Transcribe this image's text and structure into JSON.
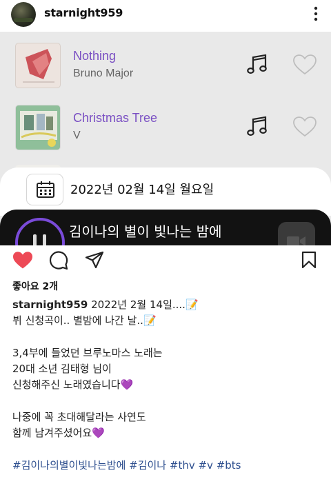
{
  "post": {
    "username": "starnight959",
    "likes": "좋아요 2개"
  },
  "playlist": [
    {
      "title": "Nothing",
      "artist": "Bruno Major"
    },
    {
      "title": "Christmas Tree",
      "artist": "V"
    }
  ],
  "date_card": {
    "date": "2022년 02월 14일 월요일"
  },
  "player": {
    "show_title": "김이나의 별이 빛나는 밤에"
  },
  "caption": {
    "username": "starnight959",
    "line1": "2022년 2월 14일....📝",
    "line2": "뷔 신청곡이.. 별밤에 나간 날..📝",
    "line3": "3,4부에 들었던 브루노마스 노래는",
    "line4": "20대 소년 김태형 님이",
    "line5": "신청해주신 노래였습니다💜",
    "line6": "나중에 꼭 초대해달라는 사연도",
    "line7": "함께 남겨주셨어요💜",
    "hashtags": "#김이나의별이빛나는밤에 #김이나 #thv #v #bts"
  },
  "colors": {
    "accent_purple": "#7a4fc3",
    "like_red": "#ed4956",
    "hashtag_blue": "#2e4f8f"
  },
  "icons": [
    "more-vertical-icon",
    "music-note-icon",
    "heart-outline-icon",
    "calendar-icon",
    "pause-icon",
    "video-icon",
    "heart-filled-icon",
    "comment-icon",
    "share-icon",
    "bookmark-icon"
  ]
}
